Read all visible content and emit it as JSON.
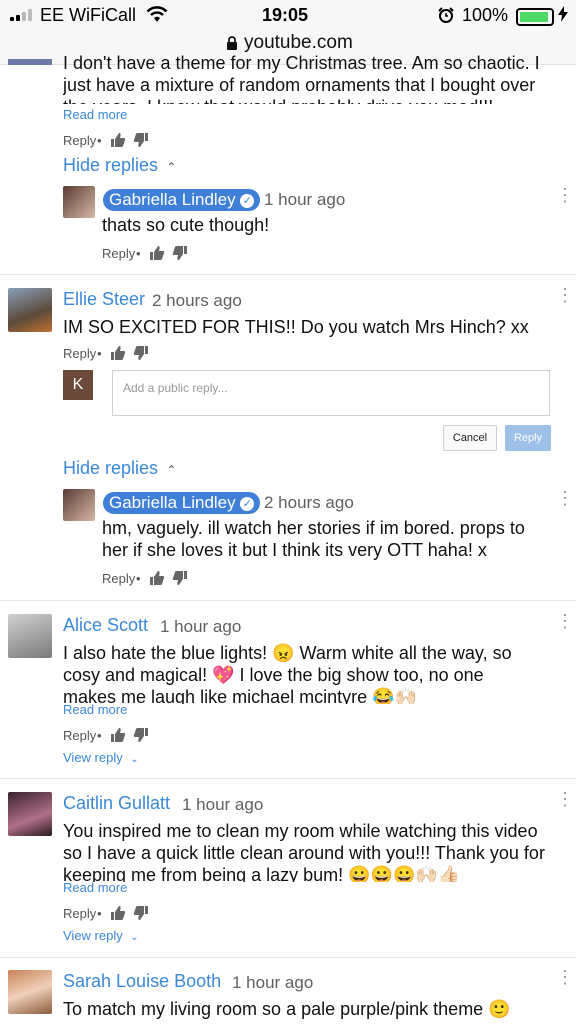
{
  "status": {
    "carrier": "EE WiFiCall",
    "time": "19:05",
    "battery": "100%",
    "url": "youtube.com"
  },
  "actions": {
    "reply": "Reply",
    "dot": "•",
    "read_more": "Read more",
    "hide_replies": "Hide replies",
    "view_reply": "View reply",
    "cancel": "Cancel",
    "reply_btn": "Reply"
  },
  "comments": [
    {
      "text": "I don't have a theme for my Christmas tree. Am so chaotic. I just have a mixture of random ornaments that I bought over the years. I know that would probably drive you mad!!!"
    },
    {
      "author": "Gabriella Lindley",
      "time": "1 hour ago",
      "text": "thats so cute though!"
    },
    {
      "author": "Ellie Steer",
      "time": "2 hours ago",
      "text": "IM SO EXCITED FOR THIS!! Do you watch Mrs Hinch? xx"
    },
    {
      "author": "Gabriella Lindley",
      "time": "2 hours ago",
      "text": "hm, vaguely. ill watch her stories if im bored. props to her if she loves it but I think its very OTT haha! x"
    },
    {
      "author": "Alice Scott",
      "time": "1 hour ago",
      "text": "I also hate the blue lights! 😠 Warm white all the way, so cosy and magical! 💖 I love the big show too, no one makes me laugh like michael mcintyre 😂🙌🏻"
    },
    {
      "author": "Caitlin Gullatt",
      "time": "1 hour ago",
      "text": "You inspired me to clean my room while watching this video so I have a quick little clean around with you!!! Thank you for keeping me from being a lazy bum! 😀😀😀🙌🏻👍🏻"
    },
    {
      "author": "Sarah Louise Booth",
      "time": "1 hour ago",
      "text": "To match my living room so a pale purple/pink theme 🙂"
    }
  ],
  "reply_box": {
    "avatar_letter": "K",
    "placeholder": "Add a public reply..."
  },
  "colors": {
    "link": "#3b88d8",
    "badge": "#3f7fd8",
    "battery": "#4cd964"
  }
}
